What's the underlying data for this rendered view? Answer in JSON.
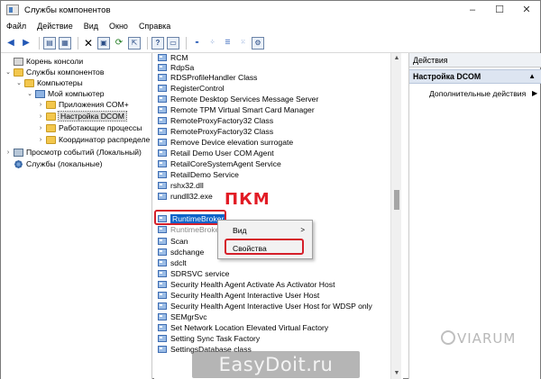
{
  "window": {
    "title": "Службы компонентов",
    "controls": [
      "–",
      "☐",
      "✕"
    ]
  },
  "menu": [
    "Файл",
    "Действие",
    "Вид",
    "Окно",
    "Справка"
  ],
  "toolbar": {
    "buttons": [
      "back-arrow",
      "forward-arrow",
      "up-folder",
      "show-tree",
      "delete",
      "properties",
      "refresh",
      "export",
      "help",
      "view-console",
      "view-large",
      "view-list",
      "view-details",
      "view-detail-list",
      "settings"
    ]
  },
  "tree": {
    "items": [
      {
        "label": "Корень консоли",
        "icon": "console-icon",
        "expander": ""
      },
      {
        "label": "Службы компонентов",
        "icon": "folder-icon",
        "expander": "⌄"
      },
      {
        "label": "Компьютеры",
        "icon": "folder-icon",
        "expander": "⌄"
      },
      {
        "label": "Мой компьютер",
        "icon": "computer-icon",
        "expander": "⌄"
      },
      {
        "label": "Приложения COM+",
        "icon": "folder-icon",
        "expander": "›"
      },
      {
        "label": "Настройка DCOM",
        "icon": "folder-icon",
        "expander": "›"
      },
      {
        "label": "Работающие процессы",
        "icon": "folder-icon",
        "expander": "›"
      },
      {
        "label": "Координатор распределе",
        "icon": "folder-icon",
        "expander": "›"
      },
      {
        "label": "Просмотр событий (Локальный)",
        "icon": "event-viewer-icon",
        "expander": "›"
      },
      {
        "label": "Службы (локальные)",
        "icon": "services-icon",
        "expander": ""
      }
    ]
  },
  "list": {
    "items": [
      "RCM",
      "RdpSa",
      "RDSProfileHandler Class",
      "RegisterControl",
      "Remote Desktop Services Message Server",
      "Remote TPM Virtual Smart Card Manager",
      "RemoteProxyFactory32 Class",
      "RemoteProxyFactory32 Class",
      "Remove Device elevation surrogate",
      "Retail Demo User COM Agent",
      "RetailCoreSystemAgent Service",
      "RetailDemo Service",
      "rshx32.dll",
      "rundll32.exe",
      "RuntimeBroker",
      "RuntimeBroker",
      "Scan",
      "sdchange",
      "sdclt",
      "SDRSVC service",
      "Security Health Agent Activate As Activator Host",
      "Security Health Agent Interactive User Host",
      "Security Health Agent Interactive User Host for WDSP only",
      "SEMgrSvc",
      "Set Network Location Elevated Virtual Factory",
      "Setting Sync Task Factory",
      "SettingsDatabase class"
    ],
    "selected_item": "RuntimeBroker"
  },
  "annotation": {
    "label": "ПКМ",
    "color": "#e21b25"
  },
  "context_menu": {
    "items": [
      "Вид",
      "Свойства"
    ],
    "submenu_arrow": ">"
  },
  "actions_pane": {
    "header": "Действия",
    "selected": "Настройка DCOM",
    "more_actions": "Дополнительные действия",
    "caret": "▲",
    "arrow": "▶"
  },
  "watermarks": {
    "viarum": "VIARUM",
    "easydoit": "EasyDoit.ru"
  },
  "colors": {
    "selection": "#0a63c9",
    "highlight_border": "#d51f2a",
    "actions_selected_bg": "#dde5f1"
  }
}
